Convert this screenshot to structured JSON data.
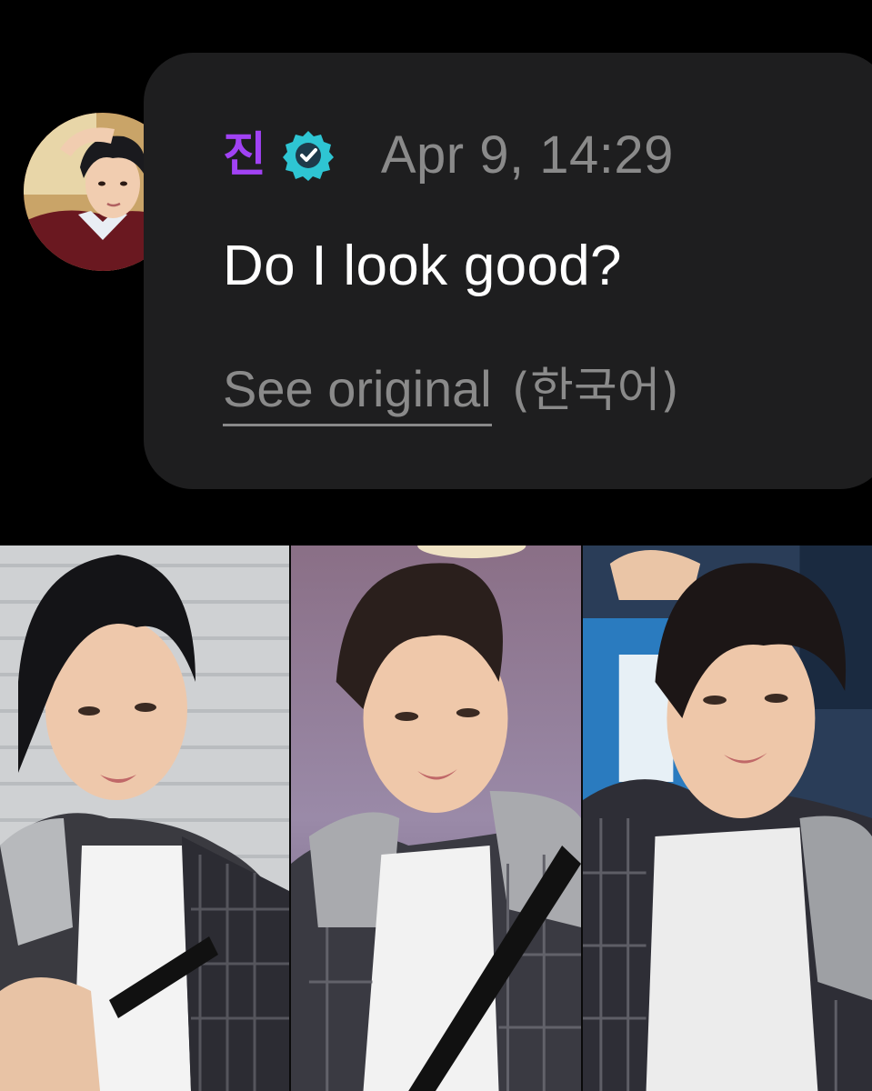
{
  "post": {
    "username": "진",
    "verified_icon": "verified-badge-icon",
    "timestamp": "Apr 9, 14:29",
    "message": "Do I look good?",
    "see_original_label": "See original",
    "original_language": "(한국어)"
  },
  "colors": {
    "background": "#000000",
    "bubble": "#1e1e1f",
    "username": "#a142f4",
    "verified_badge": "#2ec5d3",
    "timestamp": "#8a8a8a",
    "message": "#ffffff"
  },
  "photos": {
    "count": 3
  }
}
